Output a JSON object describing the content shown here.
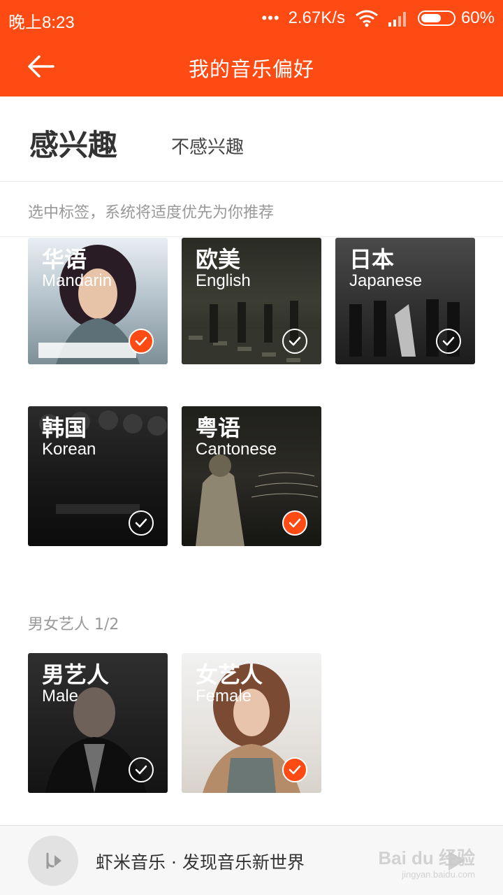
{
  "status": {
    "time": "晚上8:23",
    "dots": "•••",
    "speed": "2.67K/s",
    "battery": "60%"
  },
  "header": {
    "title": "我的音乐偏好"
  },
  "tabs": {
    "active": "感兴趣",
    "inactive": "不感兴趣"
  },
  "sections": {
    "tags_hint": "选中标签，系统将适度优先为你推荐",
    "artists_label": "男女艺人   1/2"
  },
  "cards": [
    {
      "zh": "华语",
      "en": "Mandarin",
      "selected": true
    },
    {
      "zh": "欧美",
      "en": "English",
      "selected": false
    },
    {
      "zh": "日本",
      "en": "Japanese",
      "selected": false
    },
    {
      "zh": "韩国",
      "en": "Korean",
      "selected": false
    },
    {
      "zh": "粤语",
      "en": "Cantonese",
      "selected": true
    },
    {
      "zh": "男艺人",
      "en": "Male",
      "selected": false
    },
    {
      "zh": "女艺人",
      "en": "Female",
      "selected": true
    }
  ],
  "bottom": {
    "text": "虾米音乐 · 发现音乐新世界"
  },
  "watermark": {
    "main": "Bai du 经验",
    "sub": "jingyan.baidu.com"
  },
  "colors": {
    "accent": "#fe4a13",
    "check_off": "#ffffff"
  },
  "icons": {
    "back": "back-arrow-icon",
    "check": "check-icon",
    "disc": "disc-icon",
    "play": "play-icon"
  }
}
